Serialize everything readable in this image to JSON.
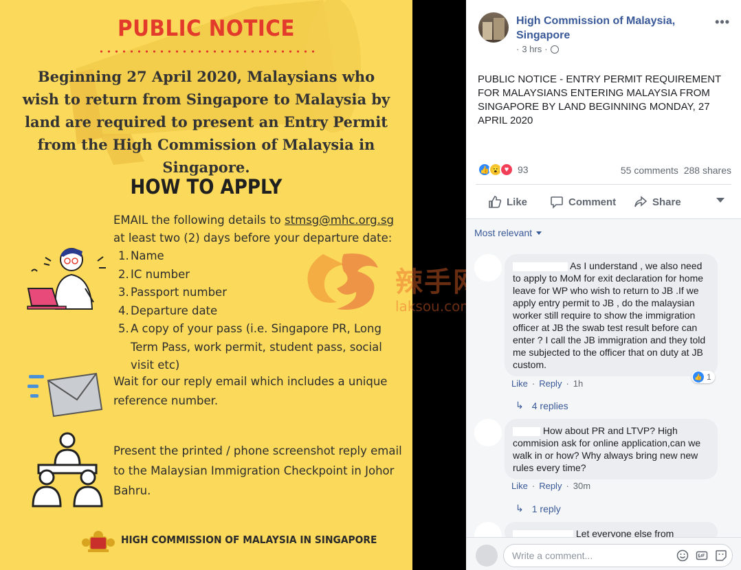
{
  "poster": {
    "title": "PUBLIC NOTICE",
    "intro": "Beginning 27 April 2020, Malaysians who wish to return from Singapore to Malaysia by land are required to present an Entry Permit from the High Commission of Malaysia in Singapore.",
    "how_title": "HOW TO APPLY",
    "email_before": "EMAIL the following details to ",
    "email_link": "stmsg@mhc.org.sg",
    "email_after": " at least two (2) days before your departure date:",
    "steps": [
      {
        "n": "1.",
        "t": "Name"
      },
      {
        "n": "2.",
        "t": "IC number"
      },
      {
        "n": "3.",
        "t": "Passport number"
      },
      {
        "n": "4.",
        "t": "Departure date"
      },
      {
        "n": "5.",
        "t": "A copy of your pass (i.e. Singapore PR, Long Term Pass, work permit, student pass, social visit etc)"
      }
    ],
    "wait": "Wait for our reply email which includes a unique reference number.",
    "present": "Present the printed / phone screenshot reply email to the Malaysian Immigration Checkpoint in Johor Bahru.",
    "footer": "HIGH COMMISSION OF MALAYSIA IN SINGAPORE"
  },
  "watermark": {
    "main": "辣手网",
    "sub": "laksou.com"
  },
  "post": {
    "page_name": "High Commission of Malaysia, Singapore",
    "time": "3 hrs",
    "text": "PUBLIC NOTICE - ENTRY PERMIT REQUIREMENT FOR MALAYSIANS ENTERING MALAYSIA FROM SINGAPORE BY LAND BEGINNING MONDAY, 27 APRIL 2020",
    "reactions_count": "93",
    "comments_count": "55 comments",
    "shares_count": "288 shares",
    "actions": {
      "like": "Like",
      "comment": "Comment",
      "share": "Share"
    },
    "more": "•••"
  },
  "comments": {
    "sort": "Most relevant",
    "items": [
      {
        "text": "As I understand , we also need to apply to MoM for exit declaration for home leave for WP who wish to return to JB .If we apply entry permit to JB , do the malaysian worker still require to show the immigration officer at JB the swab test result before can enter ? I call the JB immigration and they told me subjected to the officer that on duty at JB custom.",
        "like": "Like",
        "reply": "Reply",
        "time": "1h",
        "likes": "1",
        "replies": "4 replies"
      },
      {
        "text": "How about PR and LTVP? High commision ask for online application,can we walk in or how? Why always bring new new rules every time?",
        "like": "Like",
        "reply": "Reply",
        "time": "30m",
        "replies": "1 reply"
      },
      {
        "text": "Let everyone else from"
      }
    ],
    "write_placeholder": "Write a comment..."
  },
  "colors": {
    "poster_bg": "#fbd95a",
    "title_red": "#e23b2b",
    "fb_blue": "#385898"
  }
}
